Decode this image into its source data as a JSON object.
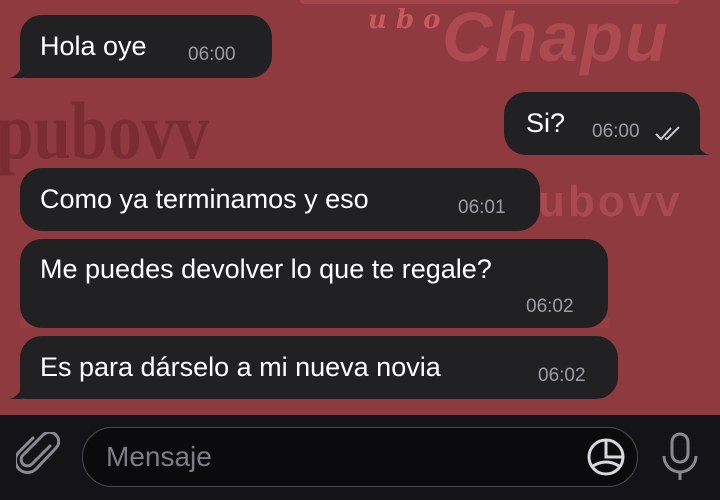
{
  "messages": [
    {
      "direction": "incoming",
      "text": "Hola oye",
      "time": "06:00"
    },
    {
      "direction": "outgoing",
      "text": "Si?",
      "time": "06:00",
      "status": "double-check-read"
    },
    {
      "direction": "incoming",
      "text": "Como ya terminamos y eso",
      "time": "06:01"
    },
    {
      "direction": "incoming",
      "text": "Me puedes devolver lo que te regale?",
      "time": "06:02"
    },
    {
      "direction": "incoming",
      "text": "Es para dárselo a mi nueva novia",
      "time": "06:02"
    }
  ],
  "composer": {
    "placeholder": "Mensaje",
    "attach_icon": "paperclip-icon",
    "sticker_icon": "sticker-icon",
    "mic_icon": "microphone-icon"
  },
  "wallpaper": {
    "text_large": "Chapu",
    "text_left": "pubovv",
    "text_vertical": "u b o",
    "text_right": "ubovv"
  },
  "colors": {
    "wallpaper": "#8e3a3e",
    "bubble": "#212124",
    "timestamp": "#9c9ca4",
    "composer_bg": "#141418"
  }
}
